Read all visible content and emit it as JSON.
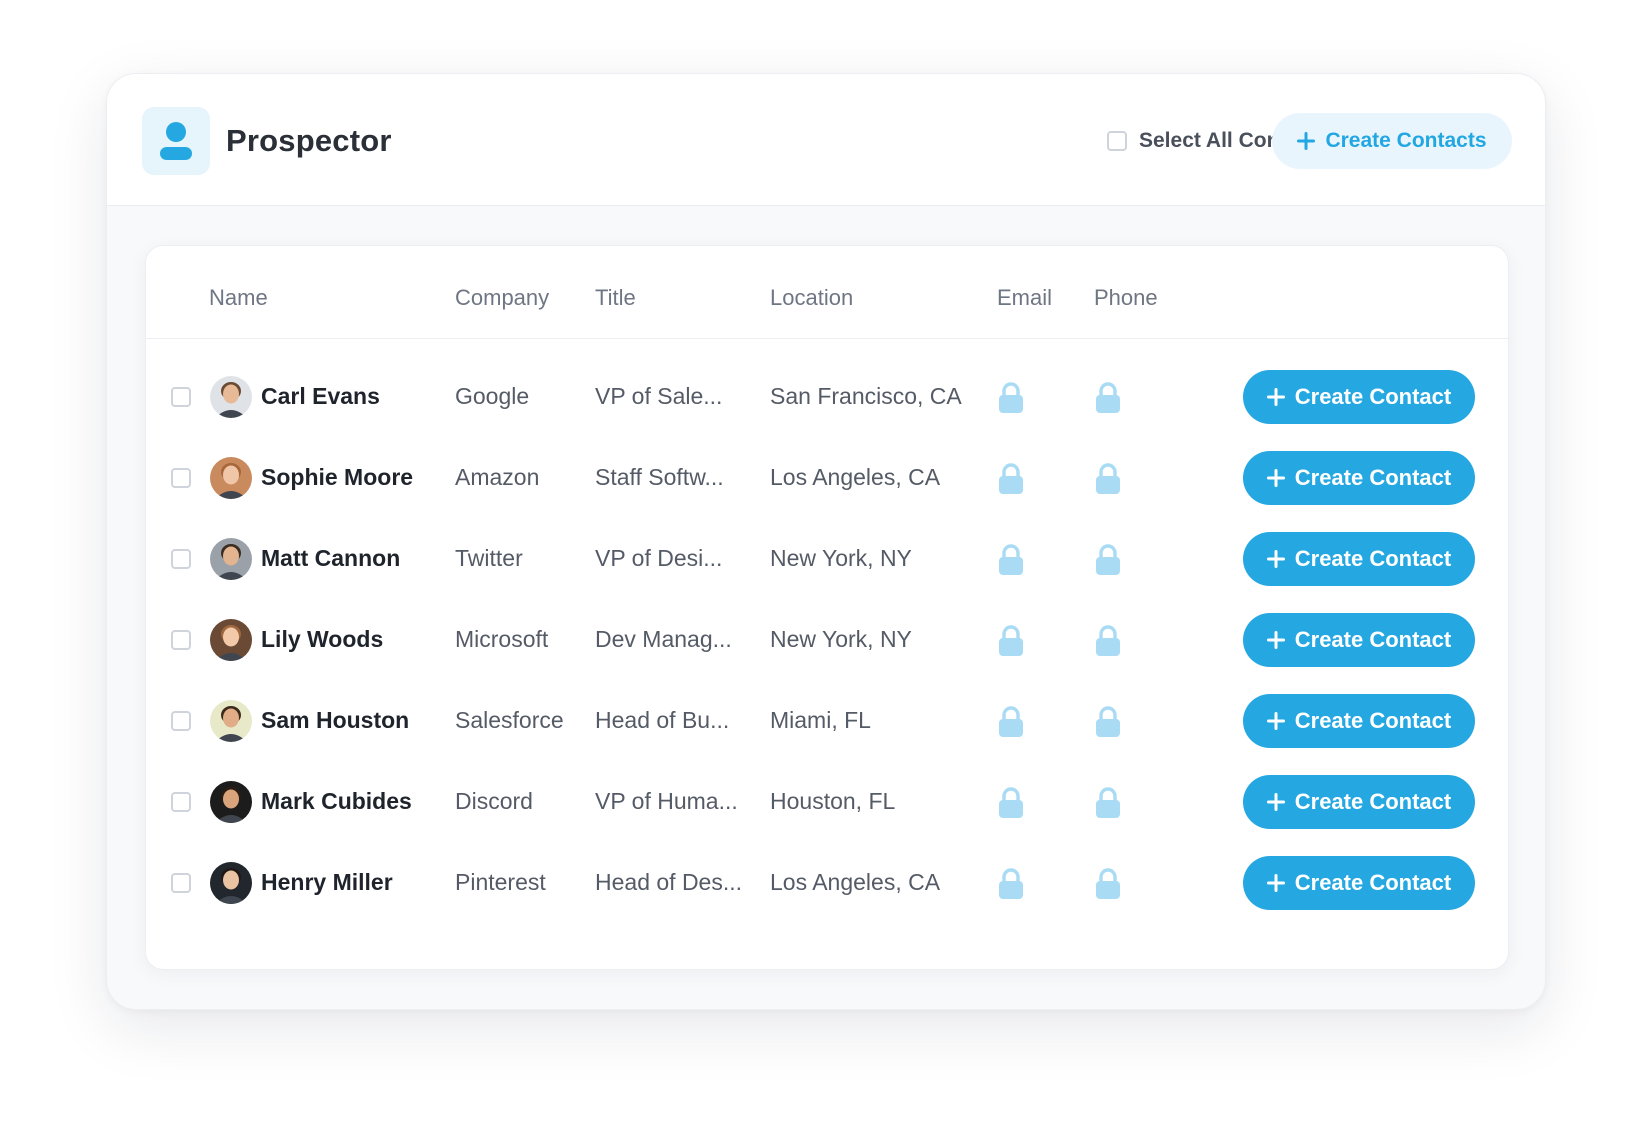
{
  "app": {
    "title": "Prospector",
    "logo_icon": "user-icon",
    "select_all_label": "Select All Contacts",
    "create_contacts_label": "Create Contacts",
    "accent": "#25a8e2"
  },
  "table": {
    "columns": [
      "Name",
      "Company",
      "Title",
      "Location",
      "Email",
      "Phone"
    ],
    "action_label": "Create Contact",
    "rows": [
      {
        "name": "Carl Evans",
        "company": "Google",
        "title": "VP of Sale...",
        "location": "San Francisco, CA",
        "avatar": {
          "bg": "#dfe3e8",
          "skin": "#e7b996",
          "hair": "#6b4a33"
        }
      },
      {
        "name": "Sophie Moore",
        "company": "Amazon",
        "title": "Staff Softw...",
        "location": "Los Angeles, CA",
        "avatar": {
          "bg": "#c98a5e",
          "skin": "#f0c6a8",
          "hair": "#a8663b"
        }
      },
      {
        "name": "Matt Cannon",
        "company": "Twitter",
        "title": "VP of Desi...",
        "location": "New York, NY",
        "avatar": {
          "bg": "#9aa1a8",
          "skin": "#e2b48f",
          "hair": "#3b2c22"
        }
      },
      {
        "name": "Lily Woods",
        "company": "Microsoft",
        "title": "Dev Manag...",
        "location": "New York, NY",
        "avatar": {
          "bg": "#6a4a35",
          "skin": "#f2c9a9",
          "hair": "#a0683f"
        }
      },
      {
        "name": "Sam Houston",
        "company": "Salesforce",
        "title": "Head of Bu...",
        "location": "Miami, FL",
        "avatar": {
          "bg": "#e7e9c9",
          "skin": "#e0ad86",
          "hair": "#3d2a1c"
        }
      },
      {
        "name": "Mark Cubides",
        "company": "Discord",
        "title": "VP of Huma...",
        "location": "Houston, FL",
        "avatar": {
          "bg": "#1c1c1c",
          "skin": "#d9a47c",
          "hair": "#2a1d15"
        }
      },
      {
        "name": "Henry Miller",
        "company": "Pinterest",
        "title": "Head of Des...",
        "location": "Los Angeles, CA",
        "avatar": {
          "bg": "#22272d",
          "skin": "#e9c3a2",
          "hair": "#1f1a17"
        }
      }
    ]
  },
  "icons": {
    "lock": "lock-icon",
    "plus": "plus-icon"
  }
}
